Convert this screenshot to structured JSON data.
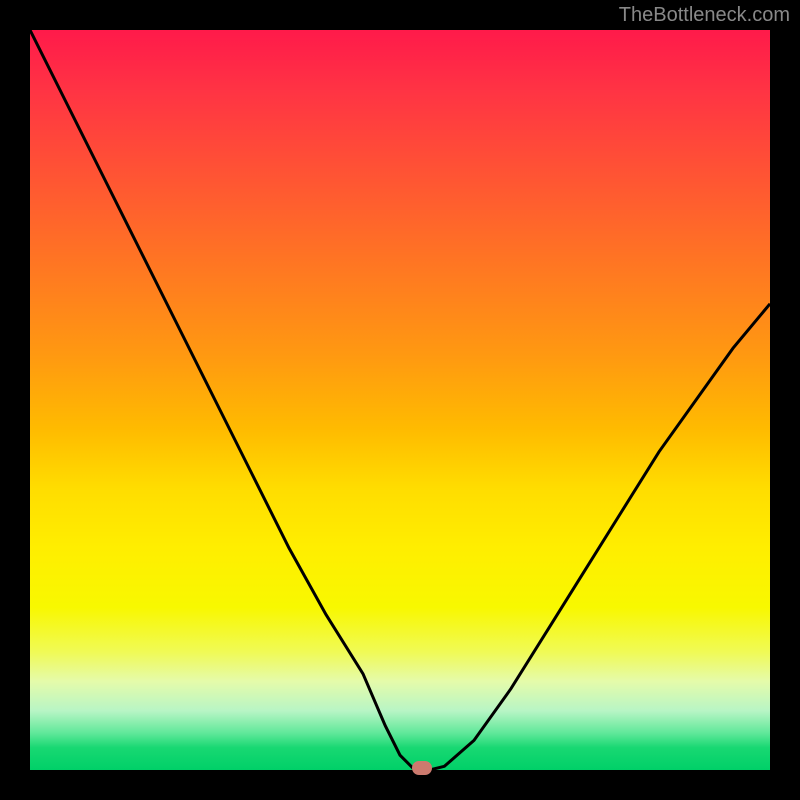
{
  "watermark": "TheBottleneck.com",
  "chart_data": {
    "type": "line",
    "title": "",
    "xlabel": "",
    "ylabel": "",
    "xlim": [
      0,
      100
    ],
    "ylim": [
      0,
      100
    ],
    "series": [
      {
        "name": "bottleneck-curve",
        "x": [
          0,
          5,
          10,
          15,
          20,
          25,
          30,
          35,
          40,
          45,
          48,
          50,
          52,
          54,
          56,
          60,
          65,
          70,
          75,
          80,
          85,
          90,
          95,
          100
        ],
        "values": [
          100,
          90,
          80,
          70,
          60,
          50,
          40,
          30,
          21,
          13,
          6,
          2,
          0,
          0,
          0.5,
          4,
          11,
          19,
          27,
          35,
          43,
          50,
          57,
          63
        ]
      }
    ],
    "marker": {
      "x": 53,
      "y": 0
    },
    "background_gradient": {
      "top": "#ff1a4a",
      "middle": "#ffee00",
      "bottom": "#00d068"
    }
  }
}
